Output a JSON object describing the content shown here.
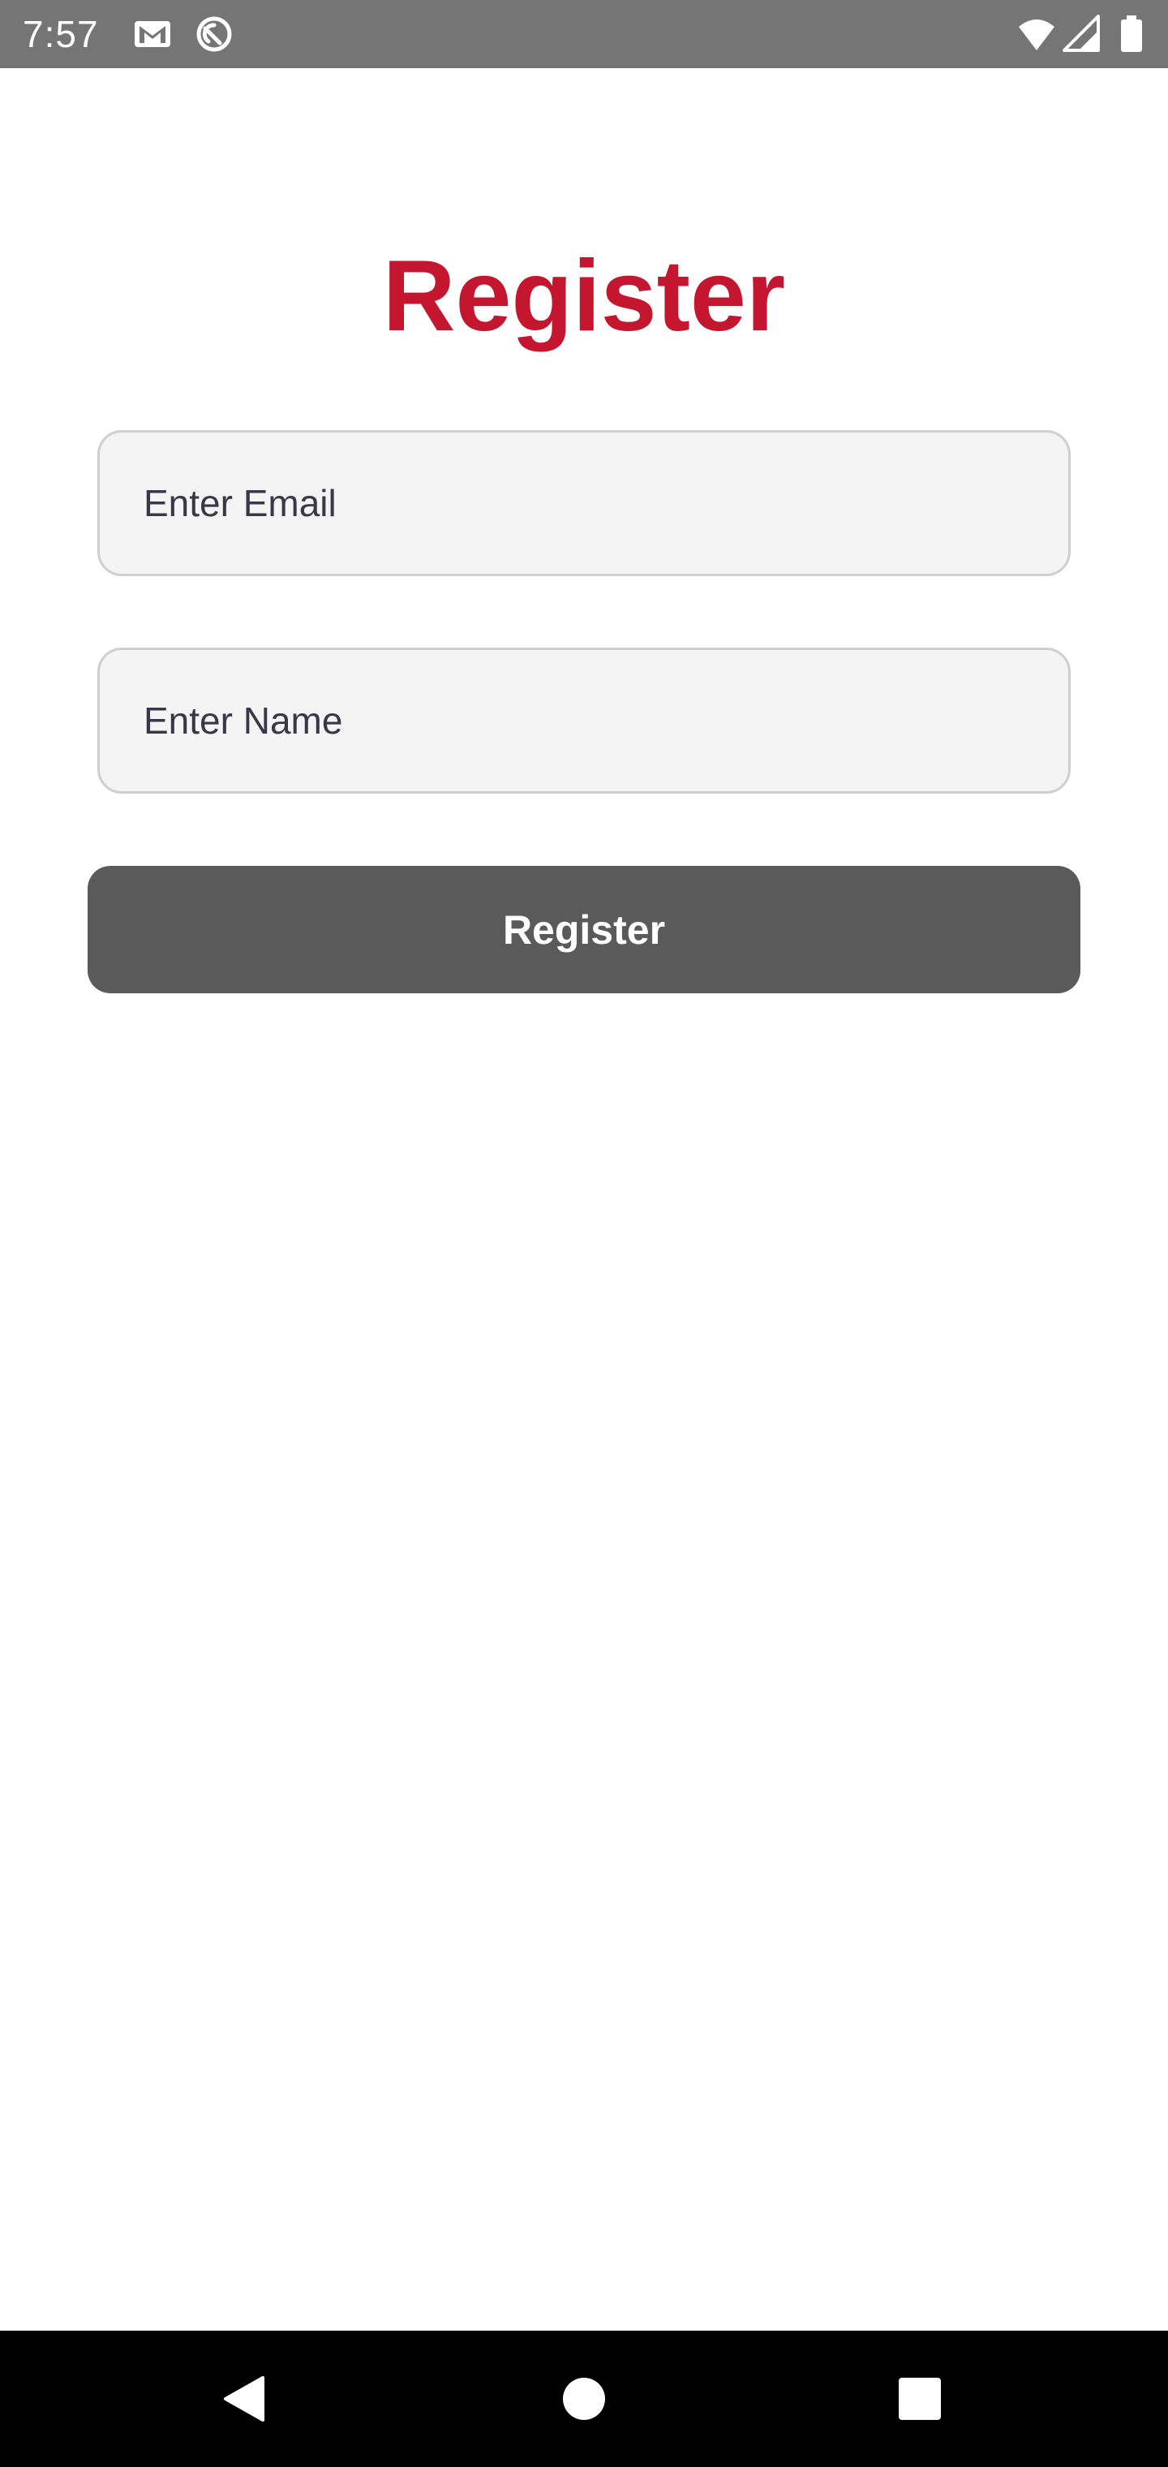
{
  "status_bar": {
    "time": "7:57",
    "icons": [
      "gmail-icon",
      "sync-icon",
      "wifi-icon",
      "cell-signal-icon",
      "battery-icon"
    ]
  },
  "form": {
    "title": "Register",
    "email_placeholder": "Enter Email",
    "email_value": "",
    "name_placeholder": "Enter Name",
    "name_value": "",
    "submit_label": "Register"
  },
  "nav_bar": {
    "buttons": [
      "back-icon",
      "home-icon",
      "recents-icon"
    ]
  },
  "colors": {
    "title": "#c4162f",
    "status_bar": "#757575",
    "button": "#5a5a5a",
    "input_background": "#f4f4f4",
    "nav_bar": "#000000"
  }
}
